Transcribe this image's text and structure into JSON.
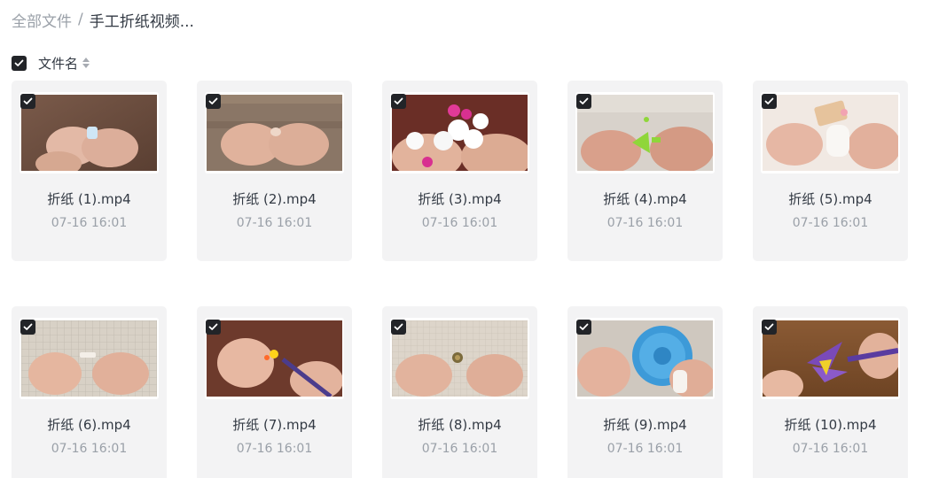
{
  "breadcrumb": {
    "root": "全部文件",
    "separator": "/",
    "current": "手工折纸视频..."
  },
  "list_header": {
    "select_all_checked": true,
    "label": "文件名",
    "sort_icon": "sort-icon"
  },
  "files": [
    {
      "name": "折纸 (1).mp4",
      "date": "07-16 16:01",
      "checked": true
    },
    {
      "name": "折纸 (2).mp4",
      "date": "07-16 16:01",
      "checked": true
    },
    {
      "name": "折纸 (3).mp4",
      "date": "07-16 16:01",
      "checked": true
    },
    {
      "name": "折纸 (4).mp4",
      "date": "07-16 16:01",
      "checked": true
    },
    {
      "name": "折纸 (5).mp4",
      "date": "07-16 16:01",
      "checked": true
    },
    {
      "name": "折纸 (6).mp4",
      "date": "07-16 16:01",
      "checked": true
    },
    {
      "name": "折纸 (7).mp4",
      "date": "07-16 16:01",
      "checked": true
    },
    {
      "name": "折纸 (8).mp4",
      "date": "07-16 16:01",
      "checked": true
    },
    {
      "name": "折纸 (9).mp4",
      "date": "07-16 16:01",
      "checked": true
    },
    {
      "name": "折纸 (10).mp4",
      "date": "07-16 16:01",
      "checked": true
    }
  ],
  "colors": {
    "checkbox": "#222428",
    "card_bg": "#f3f3f4",
    "text_primary": "#333a44",
    "text_secondary": "#9aa0a8"
  }
}
